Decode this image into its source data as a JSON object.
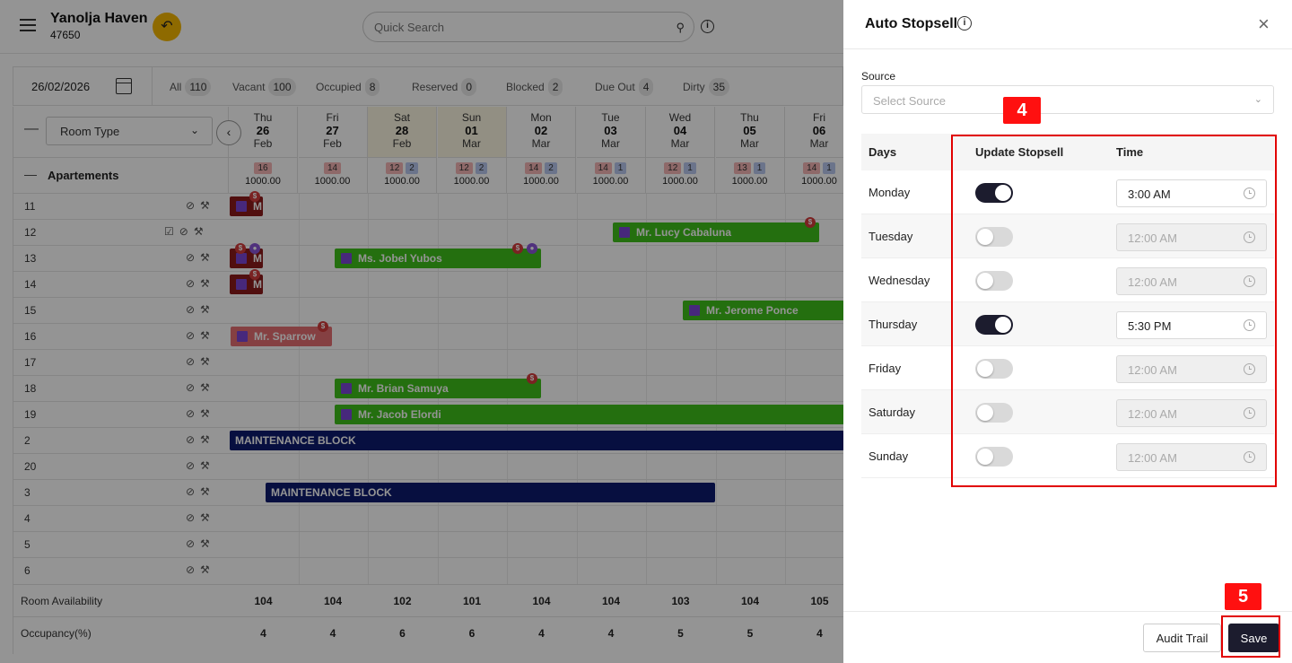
{
  "header": {
    "hotel_name": "Yanolja Haven",
    "hotel_id": "47650",
    "search_placeholder": "Quick Search"
  },
  "stats": {
    "date": "26/02/2026",
    "items": [
      {
        "label": "All",
        "count": "110"
      },
      {
        "label": "Vacant",
        "count": "100"
      },
      {
        "label": "Occupied",
        "count": "8"
      },
      {
        "label": "Reserved",
        "count": "0"
      },
      {
        "label": "Blocked",
        "count": "2"
      },
      {
        "label": "Due Out",
        "count": "4"
      },
      {
        "label": "Dirty",
        "count": "35"
      }
    ]
  },
  "grid": {
    "room_type_label": "Room Type",
    "section_label": "Apartements",
    "days": [
      {
        "dow": "Thu",
        "day": "26",
        "mon": "Feb",
        "b1": "16",
        "b2": "",
        "price": "1000.00",
        "weekend": false
      },
      {
        "dow": "Fri",
        "day": "27",
        "mon": "Feb",
        "b1": "14",
        "b2": "",
        "price": "1000.00",
        "weekend": false
      },
      {
        "dow": "Sat",
        "day": "28",
        "mon": "Feb",
        "b1": "12",
        "b2": "2",
        "price": "1000.00",
        "weekend": true
      },
      {
        "dow": "Sun",
        "day": "01",
        "mon": "Mar",
        "b1": "12",
        "b2": "2",
        "price": "1000.00",
        "weekend": true
      },
      {
        "dow": "Mon",
        "day": "02",
        "mon": "Mar",
        "b1": "14",
        "b2": "2",
        "price": "1000.00",
        "weekend": false
      },
      {
        "dow": "Tue",
        "day": "03",
        "mon": "Mar",
        "b1": "14",
        "b2": "1",
        "price": "1000.00",
        "weekend": false
      },
      {
        "dow": "Wed",
        "day": "04",
        "mon": "Mar",
        "b1": "12",
        "b2": "1",
        "price": "1000.00",
        "weekend": false
      },
      {
        "dow": "Thu",
        "day": "05",
        "mon": "Mar",
        "b1": "13",
        "b2": "1",
        "price": "1000.00",
        "weekend": false
      },
      {
        "dow": "Fri",
        "day": "06",
        "mon": "Mar",
        "b1": "14",
        "b2": "1",
        "price": "1000.00",
        "weekend": false
      }
    ],
    "rooms": [
      "11",
      "12",
      "13",
      "14",
      "15",
      "16",
      "17",
      "18",
      "19",
      "2",
      "20",
      "3",
      "4",
      "5",
      "6"
    ],
    "bookings": {
      "lucy": "Mr. Lucy Cabaluna",
      "jobel": "Ms. Jobel Yubos",
      "jerome": "Mr. Jerome Ponce",
      "sparrow": "Mr. Sparrow",
      "brian": "Mr. Brian Samuya",
      "jacob": "Mr. Jacob Elordi",
      "maint1": "MAINTENANCE BLOCK",
      "maint2": "MAINTENANCE BLOCK",
      "m_short": "M"
    },
    "room_availability_label": "Room Availability",
    "room_availability": [
      "104",
      "104",
      "102",
      "101",
      "104",
      "104",
      "103",
      "104",
      "105"
    ],
    "occupancy_label": "Occupancy(%)",
    "occupancy": [
      "4",
      "4",
      "6",
      "6",
      "4",
      "4",
      "5",
      "5",
      "4"
    ]
  },
  "panel": {
    "title": "Auto Stopsell",
    "source_label": "Source",
    "source_placeholder": "Select Source",
    "col_days": "Days",
    "col_update": "Update Stopsell",
    "col_time": "Time",
    "rows": [
      {
        "day": "Monday",
        "on": true,
        "time": "3:00 AM"
      },
      {
        "day": "Tuesday",
        "on": false,
        "time": "12:00 AM"
      },
      {
        "day": "Wednesday",
        "on": false,
        "time": "12:00 AM"
      },
      {
        "day": "Thursday",
        "on": true,
        "time": "5:30 PM"
      },
      {
        "day": "Friday",
        "on": false,
        "time": "12:00 AM"
      },
      {
        "day": "Saturday",
        "on": false,
        "time": "12:00 AM"
      },
      {
        "day": "Sunday",
        "on": false,
        "time": "12:00 AM"
      }
    ],
    "audit_label": "Audit Trail",
    "save_label": "Save"
  },
  "annotations": {
    "step4": "4",
    "step5": "5",
    "highlight_color": "#e10000"
  },
  "colors": {
    "accent_dark": "#1c1c2e",
    "booking_green": "#3fbf1a",
    "maintenance_navy": "#0d1a6e",
    "back_button": "#f5b700"
  }
}
